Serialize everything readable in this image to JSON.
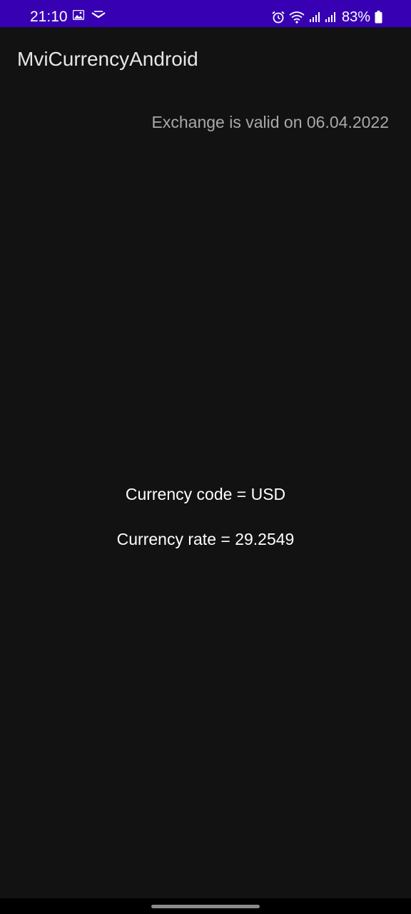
{
  "status_bar": {
    "time": "21:10",
    "battery": "83%",
    "left_icons": [
      "image-icon",
      "vpn-key-icon"
    ],
    "right_icons": [
      "alarm-icon",
      "wifi-icon",
      "signal-icon",
      "signal-icon",
      "battery-icon"
    ],
    "background_color": "#3700b3"
  },
  "app_bar": {
    "title": "MviCurrencyAndroid"
  },
  "exchange": {
    "valid_text": "Exchange is valid on 06.04.2022",
    "currency_code_text": "Currency code = USD",
    "currency_rate_text": "Currency rate = 29.2549"
  },
  "theme": {
    "background": "#121212",
    "secondary_text": "#a9a9a9",
    "primary_text": "#ffffff"
  }
}
